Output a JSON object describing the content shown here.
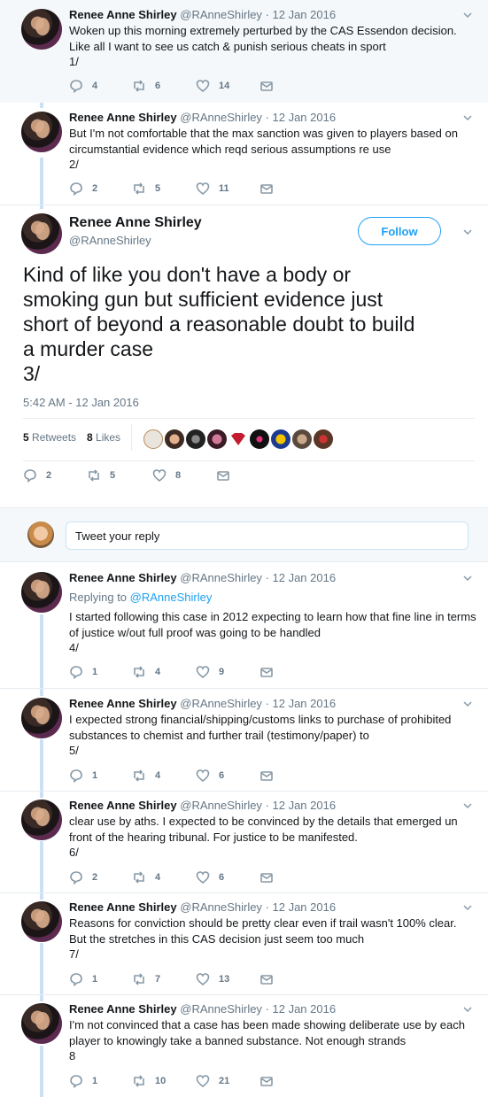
{
  "author": {
    "name": "Renee Anne Shirley",
    "handle": "@RAnneShirley"
  },
  "context_tweets": [
    {
      "date": "· 12 Jan 2016",
      "lines": [
        "Woken up this morning extremely perturbed by the CAS Essendon decision.",
        "Like all I want to see us catch & punish serious cheats in sport",
        "1/"
      ],
      "replies": "4",
      "retweets": "6",
      "likes": "14"
    },
    {
      "date": "· 12 Jan 2016",
      "lines": [
        "But I'm not comfortable that the max sanction was given to players based on",
        "circumstantial evidence which reqd serious assumptions re use",
        "2/"
      ],
      "replies": "2",
      "retweets": "5",
      "likes": "11"
    }
  ],
  "focused": {
    "follow_label": "Follow",
    "lines": [
      "Kind of like you don't have a body or",
      "smoking gun but sufficient evidence just",
      "short of beyond a reasonable doubt to build",
      "a murder case",
      "3/"
    ],
    "timestamp": "5:42 AM - 12 Jan 2016",
    "retweets_count": "5",
    "retweets_label": "Retweets",
    "likes_count": "8",
    "likes_label": "Likes",
    "replies": "2",
    "retweets": "5",
    "likes": "8"
  },
  "reply_box": {
    "placeholder": "Tweet your reply"
  },
  "replies": [
    {
      "date": "· 12 Jan 2016",
      "replying_to_label": "Replying to",
      "replying_to_handle": "@RAnneShirley",
      "lines": [
        "I started following this case in 2012 expecting to learn how that fine line in terms",
        "of justice w/out full proof was going to be handled",
        "4/"
      ],
      "replies": "1",
      "retweets": "4",
      "likes": "9"
    },
    {
      "date": "· 12 Jan 2016",
      "lines": [
        "I expected strong financial/shipping/customs links to purchase of prohibited",
        "substances to chemist and further trail (testimony/paper) to",
        "5/"
      ],
      "replies": "1",
      "retweets": "4",
      "likes": "6"
    },
    {
      "date": "· 12 Jan 2016",
      "lines": [
        "clear use by aths. I expected to be convinced by the details that emerged un",
        "front of the hearing tribunal. For justice to be manifested.",
        "6/"
      ],
      "replies": "2",
      "retweets": "4",
      "likes": "6"
    },
    {
      "date": "· 12 Jan 2016",
      "lines": [
        "Reasons for conviction should be pretty clear even if trail wasn't 100% clear.",
        "But the stretches in this CAS decision just seem too much",
        "7/"
      ],
      "replies": "1",
      "retweets": "7",
      "likes": "13"
    },
    {
      "date": "· 12 Jan 2016",
      "lines": [
        "I'm not convinced that a case has been made showing deliberate use by each",
        "player to knowingly take a banned substance. Not enough strands",
        "8"
      ],
      "replies": "1",
      "retweets": "10",
      "likes": "21"
    }
  ],
  "colors": {
    "accent": "#1da1f2",
    "thread_line": "#cce0f5",
    "muted": "#657786",
    "icon": "#8899a6"
  },
  "icons": [
    "reply-icon",
    "retweet-icon",
    "heart-icon",
    "mail-icon",
    "chevron-down-icon"
  ]
}
